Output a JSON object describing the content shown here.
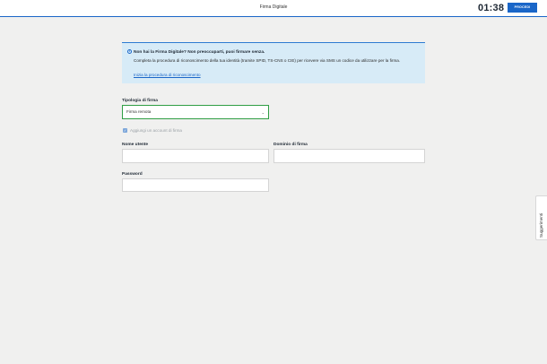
{
  "header": {
    "title": "Firma Digitale",
    "timer": "01:38",
    "proceed_label": "PROCEDI"
  },
  "notice": {
    "icon": "info-icon",
    "title": "Non hai la Firma Digitale? Non preoccuparti, puoi firmare senza.",
    "body": "Completa la procedura di riconoscimento della tua identità (tramite SPID, TS-CNS o CIE) per ricevere via SMS un codice da utilizzare per la firma.",
    "link": "Inizia la procedura di riconoscimento"
  },
  "form": {
    "signature_type_label": "Tipologia di firma",
    "signature_type_value": "Firma remota",
    "add_account_label": "Aggiungi un account di firma",
    "username_label": "Nome utente",
    "username_value": "",
    "domain_label": "Dominio di firma",
    "domain_value": "",
    "password_label": "Password",
    "password_value": ""
  },
  "side_tab": {
    "label": "Suggerimenti"
  },
  "colors": {
    "accent": "#1a66c8",
    "notice_bg": "#d7ebf7",
    "select_border": "#2f9e44",
    "page_bg": "#f0f0ef"
  }
}
